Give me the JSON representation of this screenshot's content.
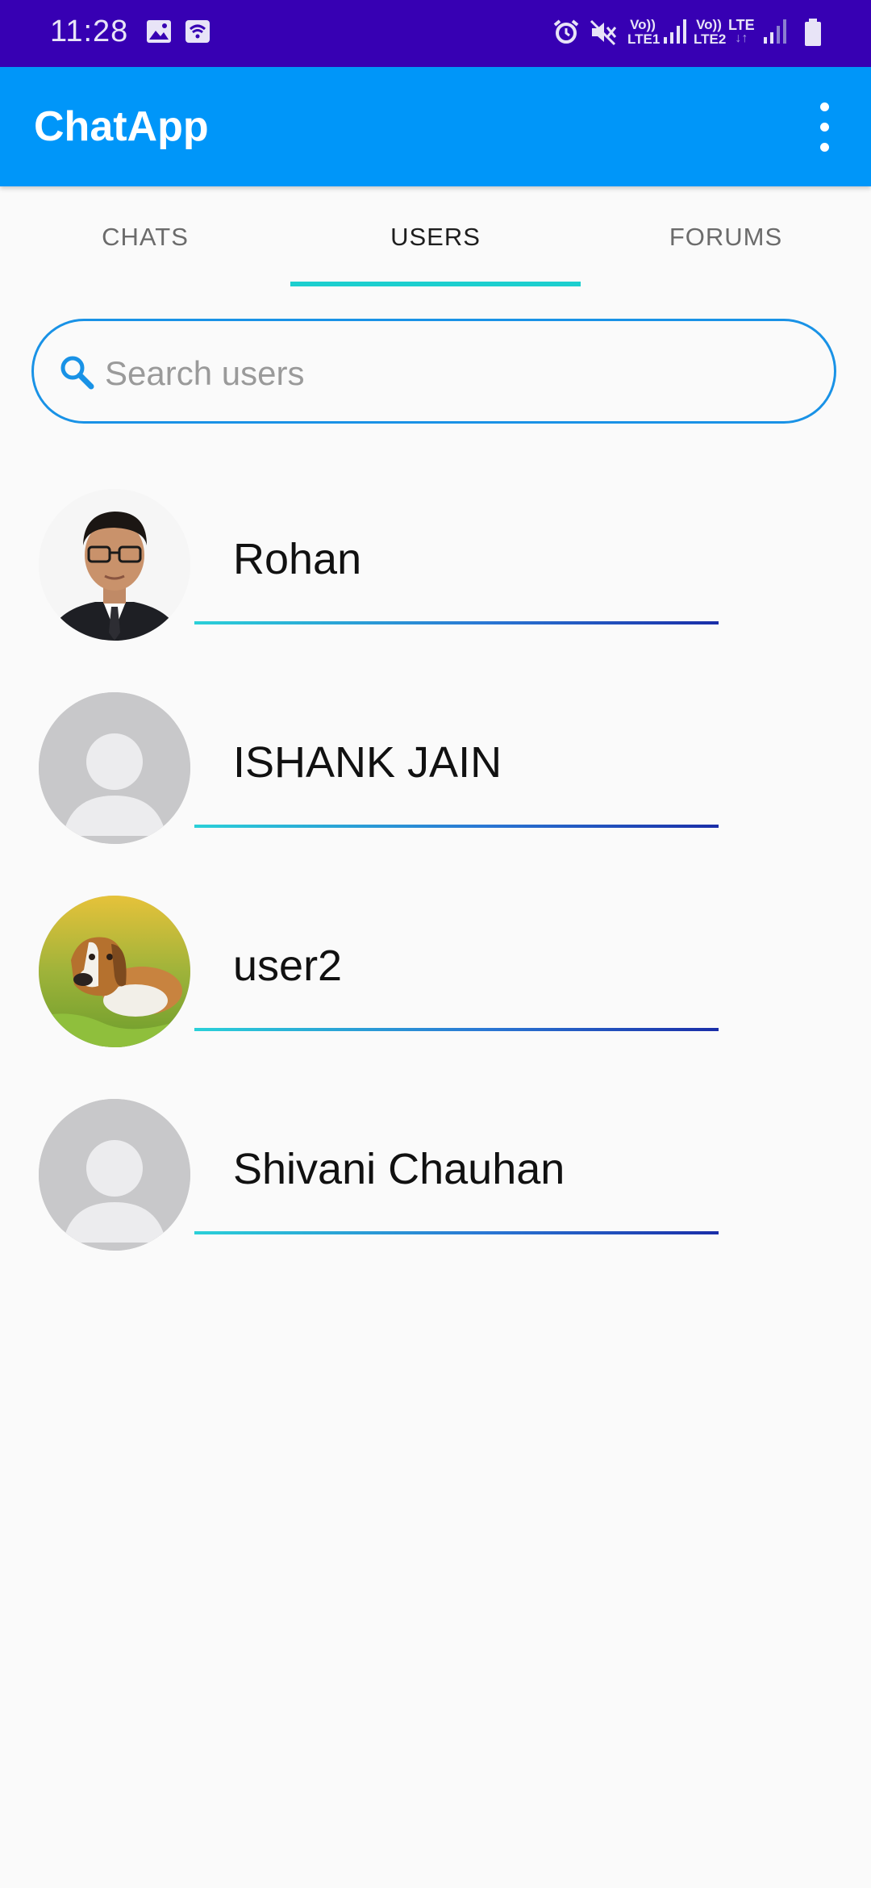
{
  "status_bar": {
    "time": "11:28",
    "sim1_label": "Vo))",
    "sim1_sub": "LTE1",
    "sim2_label": "Vo))",
    "sim2_sub": "LTE2",
    "network": "LTE",
    "icons": [
      "image-icon",
      "wifi-icon",
      "alarm-icon",
      "mute-icon",
      "signal-icon",
      "signal-icon",
      "battery-icon"
    ]
  },
  "app_bar": {
    "title": "ChatApp",
    "menu_icon": "more-vertical-icon"
  },
  "tabs": [
    {
      "label": "CHATS",
      "active": false
    },
    {
      "label": "USERS",
      "active": true
    },
    {
      "label": "FORUMS",
      "active": false
    }
  ],
  "search": {
    "placeholder": "Search users",
    "value": "",
    "icon": "search-icon"
  },
  "users": [
    {
      "name": "Rohan",
      "avatar": "profile-photo"
    },
    {
      "name": "ISHANK JAIN",
      "avatar": "default-avatar"
    },
    {
      "name": "user2",
      "avatar": "dog-photo"
    },
    {
      "name": "Shivani Chauhan",
      "avatar": "default-avatar"
    }
  ],
  "colors": {
    "status_bar": "#3700b3",
    "app_bar": "#0096f9",
    "tab_indicator": "#1ccfcf",
    "search_border": "#1992e6",
    "divider_start": "#2ad0d8",
    "divider_end": "#1a2ea8"
  }
}
